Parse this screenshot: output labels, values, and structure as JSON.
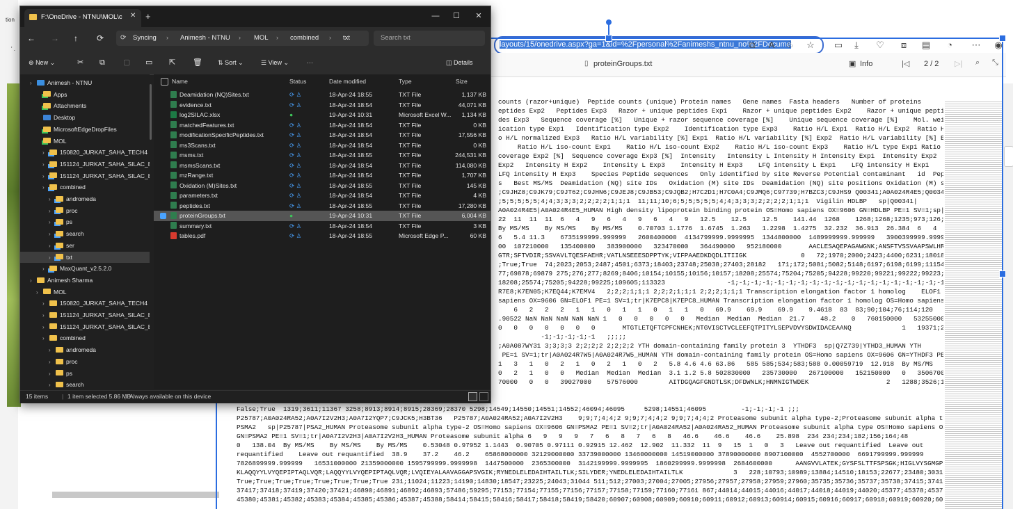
{
  "browser": {
    "address_url": "layouts/15/onedrive.aspx?ga=1&id=%2Fpersonal%2Fanimeshs_ntnu_no%2FDocume",
    "viewer_file_title": "proteinGroups.txt",
    "info_label": "Info",
    "page_indicator": "2 / 2",
    "left_text_a": "tion",
    "left_text_b": "' ."
  },
  "text_lines": [
    "counts (razor+unique)  Peptide counts (unique) Protein names   Gene names  Fasta headers   Number of proteins",
    "eptides Exp2   Peptides Exp3   Razor + unique peptides Exp1    Razor + unique peptides Exp2    Razor + unique peptides",
    "des Exp3   Sequence coverage [%]   Unique + razor sequence coverage [%]    Unique sequence coverage [%]    Mol. weight",
    "ication type Exp1   Identification type Exp2    Identification type Exp3    Ratio H/L Exp1  Ratio H/L Exp2  Ratio H/L",
    "o H/L normalized Exp3   Ratio H/L variability [%] Exp1  Ratio H/L variability [%] Exp2  Ratio H/L variability [%] Exp3",
    "     Ratio H/L iso-count Exp1    Ratio H/L iso-count Exp2    Ratio H/L iso-count Exp3    Ratio H/L type Exp1 Ratio H/L",
    "coverage Exp2 [%]  Sequence coverage Exp3 [%]  Intensity   Intensity L Intensity H Intensity Exp1  Intensity Exp2",
    "Exp2   Intensity H Exp2    Intensity L Exp3    Intensity H Exp3    LFQ intensity L Exp1    LFQ intensity H Exp1    LFQ",
    "LFQ intensity H Exp3    Species Peptide sequences   Only identified by site Reverse Potential contaminant   id  Peptide",
    "s   Best MS/MS  Deamidation (NQ) site IDs   Oxidation (M) site IDs  Deamidation (NQ) site positions Oxidation (M) site",
    "",
    ";C9JHZ8;C9JK79;C9JT62;C9JHN6;C9JEJ8;C9JB53;C9JQB2;H7C2D1;H7C0A4;C9JMQ6;C97739;H7BZC3;C9JHS9 Q00341;A0A024R4E5;Q00341-2;",
    ";5;5;5;5;5;4;4;3;3;3;2;2;2;2;1;1;1  11;11;10;6;5;5;5;5;5;4;4;3;3;3;2;2;2;2;1;1;1  Vigilin HDLBP   sp|Q00341|",
    "A0A024R4E5|A0A024R4E5_HUMAN High density lipoprotein binding protein OS=Homo sapiens OX=9606 GN=HDLBP PE=1 SV=1;sp|",
    "22  11  11  11  6   4   9   6   4   9   6   4   9   12.5    12.5    12.5    141.44  1268    1268;1268;1235;973;126;224;",
    "By MS/MS    By MS/MS    By MS/MS    0.70703 1.1776  1.6745  1.263   1.2298  1.4275  32.232  36.913  26.384  6   4   8",
    "6   5.4 11.3    6735199999.999999   2600400000  4134799999.9999995  1344800000  1489999999.999999   3900399999.9999995",
    "00  107210000   135400000   383900000   323470000   364490000   952180000       AACLESAQEPAGAWGNK;ANSFTVSSVAAPSWLHR;",
    "GTR;SFTVDIR;SSVAVLTQESFAEHR;VATLNSEEESDPPTYK;VIFPAAEDKDQDLITIIGK              0   72;1970;2000;2423;4400;6231;18018;",
    ";True;True  74;2023;2053;2487;4501;6373;18403;23748;25038;27403;28182   171;172;5081;5082;5148;6197;6198;6199;11154;",
    "77;69878;69879 275;276;277;8269;8406;10154;10155;10156;10157;18208;25574;75204;75205;94228;99220;99221;99222;99223;",
    "18208;25574;75205;94228;99225;109605;113323                -1;-1;-1;-1;-1;-1;-1;-1;-1;-1;-1;-1;-1;-1;-1;-1;-1;-1;-1;",
    "",
    "R7E8;K7EN05;K7EQ44;K7EMV4   2;2;2;1;1;1 2;2;2;1;1;1 2;2;2;1;1;1 Transcription elongation factor 1 homolog    ELOF1   sp|",
    "sapiens OX=9606 GN=ELOF1 PE=1 SV=1;tr|K7EPC8|K7EPC8_HUMAN Transcription elongation factor 1 homolog OS=Homo sapiens",
    "    6   2   2   2   1   1   0   1   1   0   1   1   0   69.9    69.9    69.9    9.4618  83  83;90;104;76;114;120",
    ".90522 NaN NaN NaN NaN NaN 1   0   0   0   0   0   Median  Median  Median  21.7    48.2    0   760150000   532550000",
    "0   0   0   0   0   0   0       MTGTLETQFTCPFCNHEK;NTGVISCTVCLEEFQTPITYLSEPVDVYSDWIDACEAANQ             1   19371;20694",
    "           -1;-1;-1;-1;-1   ;;;;;",
    ";A0A087WY31 3;3;3;3 2;2;2;2 2;2;2;2 YTH domain-containing family protein 3  YTHDF3  sp|Q7Z739|YTHD3_HUMAN YTH",
    " PE=1 SV=1;tr|A0A024R7W5|A0A024R7W5_HUMAN YTH domain-containing family protein OS=Homo sapiens OX=9606 GN=YTHDF3 PE=1",
    "1   3   1   0   2   1   0   2   1   0   2   5.8 4.6 4.6 63.86   585 585;534;583;588 0.00059719  12.918  By MS/MS    By matching By",
    "0   2   1   0   0   Median  Median  Median  3.1 1.2 5.8 502830000   235730000   267100000   152150000   0   350670000",
    "70000   0   0   39027000    57576000        AITDGQAGFGNDTLSK;DFDWNLK;HNMNIGTWDEK                    2   1288;3526;11133 True;"
  ],
  "text_lines_bottom": [
    "False;True  1319;3611;11367 3258;8913;8914;8915;28369;28370 5298;14549;14550;14551;14552;46094;46095     5298;14551;46095         -1;-1;-1;-1 ;;;",
    "P25787;A0A024RA52;A0A7I2V2H3;A0A7I2YQP7;C9JCK5;H3BT36   P25787;A0A024RA52;A0A7I2V2H3    9;9;7;4;4;2 9;9;7;4;4;2 9;9;7;4;4;2 Proteasome subunit alpha type-2;Proteasome subunit alpha type",
    "PSMA2   sp|P25787|PSA2_HUMAN Proteasome subunit alpha type-2 OS=Homo sapiens OX=9606 GN=PSMA2 PE=1 SV=2;tr|A0A024RA52|A0A024RA52_HUMAN Proteasome subunit alpha type OS=Homo sapiens OX=9606",
    "GN=PSMA2 PE=1 SV=1;tr|A0A7I2V2H3|A0A7I2V2H3_HUMAN Proteasome subunit alpha 6   9   9   9   7   6   8   7   6   8   46.6    46.6    46.6    25.898  234 234;234;182;156;164;48",
    "0   138.04  By MS/MS    By MS/MS    By MS/MS    0.53048 0.97952 1.1443  0.90705 0.97111 0.92915 12.462  12.902  11.332  11  9   15  1   0   3   Leave out requantified  Leave out",
    "requantified    Leave out requantified  38.9    37.2    46.2    65868000000 32129000000 33739000000 13460000000 14519000000 37890000000 8907100000  4552700000  6691799999.999999",
    "7826899999.999999   16531000000 21359000000 1595799999.9999998  1447500000  2365300000  3142199999.9999995  1860299999.9999998  2684600000      AANGVVLATEK;GYSFSLTTFSPSGK;HIGLVYSGMGPDYR;",
    "KLAQQYYLVYQEPIPTAQLVQR;LAQQYYLVYQEPIPTAQLVQR;LVQIEYALAAVAGGAPSVGIK;RYNEDLELEDAIHTAILTLK;SILYDER;YNEDLELEDAIHTAILTLK             3   228;10793;10989;13884;14510;18153;22677;23480;30318 True;",
    "True;True;True;True;True;True;True;True 231;11024;11223;14190;14830;18547;23225;24043;31044 511;512;27003;27004;27005;27956;27957;27958;27959;27960;35735;35736;35737;35738;37415;37416;",
    "37417;37418;37419;37420;37421;46890;46891;46892;46893;57486;59295;77153;77154;77155;77156;77157;77158;77159;77160;77161 867;44014;44015;44016;44017;44018;44019;44020;45377;45378;45379;",
    "45380;45381;45382;45383;45384;45385;45386;45387;45388;58414;58415;58416;58417;58418;58419;58420;60907;60908;60909;60910;60911;60912;60913;60914;60915;60916;60917;60918;60919;60920;60921;"
  ],
  "explorer": {
    "tab_title": "F:\\OneDrive - NTNU\\MOL\\c",
    "new_tab": "+",
    "breadcrumb": [
      "Syncing",
      "Animesh - NTNU",
      "MOL",
      "combined",
      "txt"
    ],
    "search_placeholder": "Search txt",
    "toolbar": {
      "new": "New",
      "sort": "Sort",
      "view": "View",
      "more": "···",
      "details": "Details"
    },
    "nav_items": [
      {
        "label": "Animesh - NTNU",
        "indent": 0,
        "type": "cloud"
      },
      {
        "label": "Apps",
        "indent": 1,
        "type": "folder-green"
      },
      {
        "label": "Attachments",
        "indent": 1,
        "type": "folder-green"
      },
      {
        "label": "Desktop",
        "indent": 1,
        "type": "desktop"
      },
      {
        "label": "MicrosoftEdgeDropFiles",
        "indent": 1,
        "type": "folder-green"
      },
      {
        "label": "MOL",
        "indent": 1,
        "type": "folder-green"
      },
      {
        "label": "150820_JURKAT_SAHA_TECH4",
        "indent": 2,
        "type": "folder-sync"
      },
      {
        "label": "151124_JURKAT_SAHA_SILAC_Biol2_t",
        "indent": 2,
        "type": "folder-sync"
      },
      {
        "label": "151124_JURKAT_SAHA_SILAC_Biol3_t",
        "indent": 2,
        "type": "folder-sync"
      },
      {
        "label": "combined",
        "indent": 2,
        "type": "folder-sync"
      },
      {
        "label": "andromeda",
        "indent": 3,
        "type": "folder-sync"
      },
      {
        "label": "proc",
        "indent": 3,
        "type": "folder-sync"
      },
      {
        "label": "ps",
        "indent": 3,
        "type": "folder-sync"
      },
      {
        "label": "search",
        "indent": 3,
        "type": "folder-sync"
      },
      {
        "label": "ser",
        "indent": 3,
        "type": "folder-sync"
      },
      {
        "label": "txt",
        "indent": 3,
        "type": "folder-sync",
        "selected": true
      },
      {
        "label": "MaxQuant_v2.5.2.0",
        "indent": 2,
        "type": "folder-sync"
      },
      {
        "label": "Animesh Sharma",
        "indent": 0,
        "type": "folder"
      },
      {
        "label": "MOL",
        "indent": 1,
        "type": "folder"
      },
      {
        "label": "150820_JURKAT_SAHA_TECH4",
        "indent": 2,
        "type": "folder"
      },
      {
        "label": "151124_JURKAT_SAHA_SILAC_Biol2_t",
        "indent": 2,
        "type": "folder"
      },
      {
        "label": "151124_JURKAT_SAHA_SILAC_Biol3_t",
        "indent": 2,
        "type": "folder"
      },
      {
        "label": "combined",
        "indent": 2,
        "type": "folder"
      },
      {
        "label": "andromeda",
        "indent": 3,
        "type": "folder"
      },
      {
        "label": "proc",
        "indent": 3,
        "type": "folder"
      },
      {
        "label": "ps",
        "indent": 3,
        "type": "folder"
      },
      {
        "label": "search",
        "indent": 3,
        "type": "folder"
      }
    ],
    "columns": {
      "name": "Name",
      "status": "Status",
      "date": "Date modified",
      "type": "Type",
      "size": "Size"
    },
    "files": [
      {
        "name": "Deamidation (NQ)Sites.txt",
        "status": "sync",
        "date": "18-Apr-24 18:55",
        "type": "TXT File",
        "size": "1,137 KB"
      },
      {
        "name": "evidence.txt",
        "status": "sync",
        "date": "18-Apr-24 18:54",
        "type": "TXT File",
        "size": "44,071 KB"
      },
      {
        "name": "log2SILAC.xlsx",
        "status": "ok",
        "date": "19-Apr-24 10:31",
        "type": "Microsoft Excel W...",
        "size": "1,134 KB",
        "icon": "excel"
      },
      {
        "name": "matchedFeatures.txt",
        "status": "sync",
        "date": "18-Apr-24 18:54",
        "type": "TXT File",
        "size": "0 KB"
      },
      {
        "name": "modificationSpecificPeptides.txt",
        "status": "sync",
        "date": "18-Apr-24 18:54",
        "type": "TXT File",
        "size": "17,556 KB"
      },
      {
        "name": "ms3Scans.txt",
        "status": "sync",
        "date": "18-Apr-24 18:54",
        "type": "TXT File",
        "size": "0 KB"
      },
      {
        "name": "msms.txt",
        "status": "sync",
        "date": "18-Apr-24 18:55",
        "type": "TXT File",
        "size": "244,531 KB"
      },
      {
        "name": "msmsScans.txt",
        "status": "sync",
        "date": "18-Apr-24 18:54",
        "type": "TXT File",
        "size": "114,080 KB"
      },
      {
        "name": "mzRange.txt",
        "status": "sync",
        "date": "18-Apr-24 18:54",
        "type": "TXT File",
        "size": "1,707 KB"
      },
      {
        "name": "Oxidation (M)Sites.txt",
        "status": "sync",
        "date": "18-Apr-24 18:55",
        "type": "TXT File",
        "size": "145 KB"
      },
      {
        "name": "parameters.txt",
        "status": "sync",
        "date": "18-Apr-24 18:54",
        "type": "TXT File",
        "size": "4 KB"
      },
      {
        "name": "peptides.txt",
        "status": "sync",
        "date": "18-Apr-24 18:55",
        "type": "TXT File",
        "size": "17,280 KB"
      },
      {
        "name": "proteinGroups.txt",
        "status": "ok",
        "date": "19-Apr-24 10:31",
        "type": "TXT File",
        "size": "6,004 KB",
        "selected": true
      },
      {
        "name": "summary.txt",
        "status": "sync",
        "date": "18-Apr-24 18:54",
        "type": "TXT File",
        "size": "3 KB"
      },
      {
        "name": "tables.pdf",
        "status": "sync",
        "date": "18-Apr-24 18:55",
        "type": "Microsoft Edge P...",
        "size": "60 KB",
        "icon": "pdf"
      }
    ],
    "status": {
      "items": "15 items",
      "selected": "1 item selected  5.86 MB",
      "availability": "Always available on this device"
    }
  },
  "colors": {
    "accent": "#2b6de0",
    "excel_green": "#1d7a45",
    "pdf_red": "#d83b2f",
    "sync_blue": "#4aa3ff",
    "ok_green": "#3ec35a"
  }
}
